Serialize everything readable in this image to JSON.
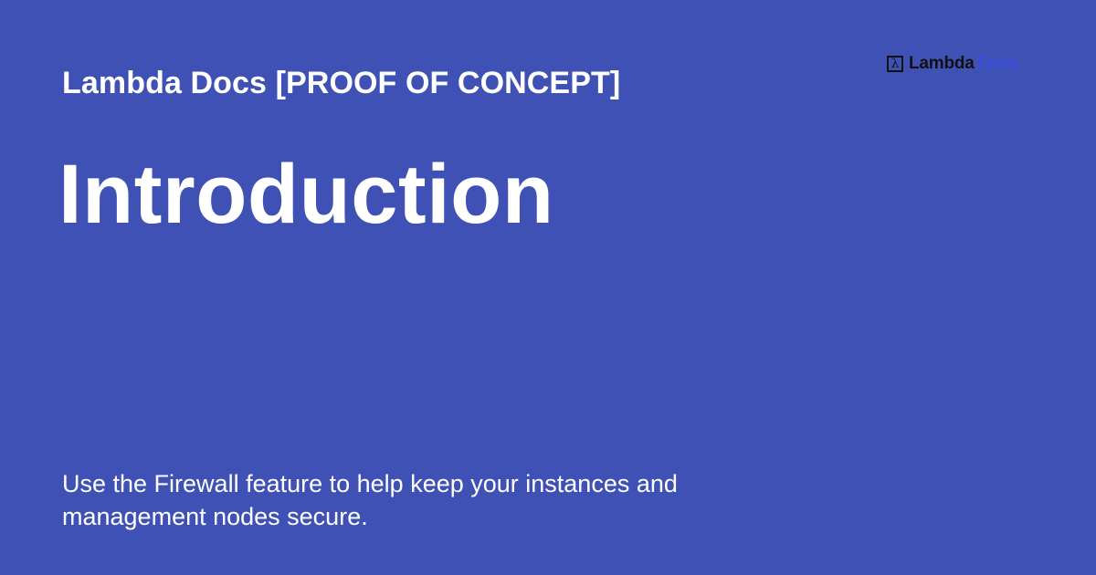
{
  "site": {
    "title": "Lambda Docs [PROOF OF CONCEPT]"
  },
  "page": {
    "title": "Introduction",
    "description": "Use the Firewall feature to help keep your instances and management nodes secure."
  },
  "logo": {
    "mark": "λ",
    "mark_icon": "lambda-icon",
    "word_primary": "Lambda",
    "word_secondary": "Docs",
    "primary_color": "#111111",
    "secondary_color": "#3b4cf0"
  },
  "colors": {
    "background": "#3f51b5",
    "text": "#ffffff"
  }
}
